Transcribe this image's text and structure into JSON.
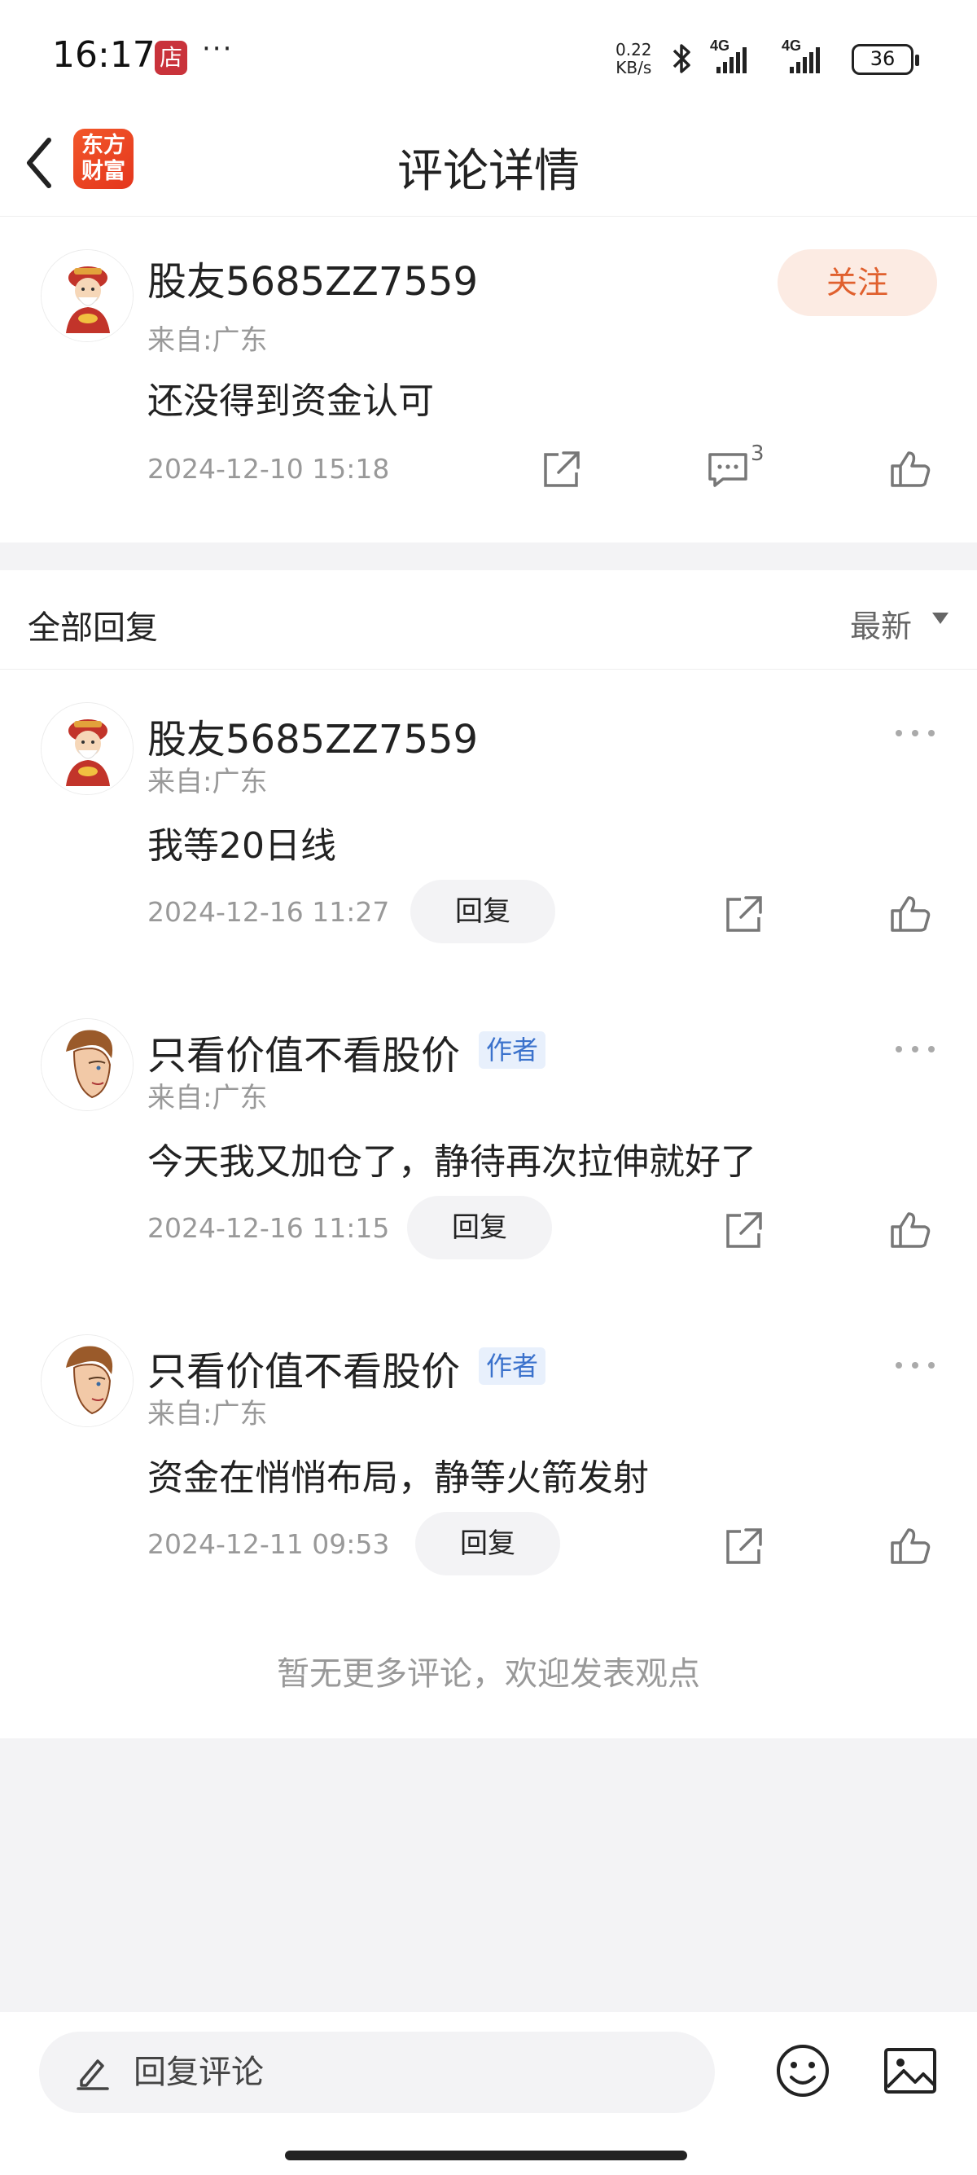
{
  "status_bar": {
    "time": "16:17",
    "shop_badge": "店",
    "more": "···",
    "net_speed_value": "0.22",
    "net_speed_unit": "KB/s",
    "signal1": "4G",
    "signal2": "4G",
    "battery": "36"
  },
  "header": {
    "title": "评论详情",
    "logo_line1": "东方",
    "logo_line2": "财富"
  },
  "main_comment": {
    "username": "股友5685ZZ7559",
    "from": "来自:广东",
    "content": "还没得到资金认可",
    "time": "2024-12-10 15:18",
    "follow_label": "关注",
    "comment_count": "3"
  },
  "replies_section": {
    "title": "全部回复",
    "sort_label": "最新"
  },
  "replies": [
    {
      "username": "股友5685ZZ7559",
      "from": "来自:广东",
      "content": "我等20日线",
      "time": "2024-12-16 11:27",
      "reply_label": "回复",
      "is_author": false
    },
    {
      "username": "只看价值不看股价",
      "badge": "作者",
      "from": "来自:广东",
      "content": "今天我又加仓了，静待再次拉伸就好了",
      "time": "2024-12-16 11:15",
      "reply_label": "回复",
      "is_author": true
    },
    {
      "username": "只看价值不看股价",
      "badge": "作者",
      "from": "来自:广东",
      "content": "资金在悄悄布局，静等火箭发射",
      "time": "2024-12-11 09:53",
      "reply_label": "回复",
      "is_author": true
    }
  ],
  "footer_note": "暂无更多评论，欢迎发表观点",
  "bottom_bar": {
    "input_placeholder": "回复评论"
  },
  "colors": {
    "accent_orange": "#e0602e",
    "follow_bg": "#fcebe3",
    "author_badge_text": "#3b72cc",
    "author_badge_bg": "#e8f0fc",
    "page_bg": "#f3f3f5"
  },
  "icons": [
    "back-icon",
    "share-icon",
    "comment-icon",
    "like-icon",
    "more-icon",
    "pencil-icon",
    "emoji-icon",
    "image-icon",
    "bluetooth-icon",
    "signal-icon",
    "battery-icon"
  ]
}
